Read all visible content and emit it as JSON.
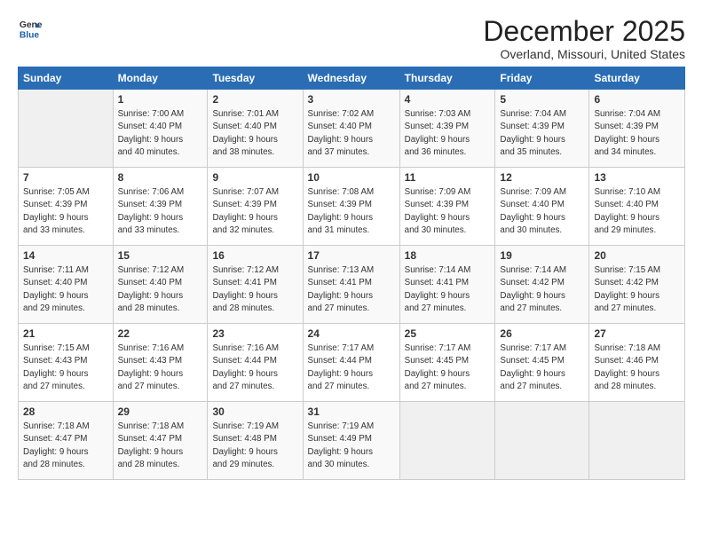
{
  "header": {
    "logo_line1": "General",
    "logo_line2": "Blue",
    "month": "December 2025",
    "location": "Overland, Missouri, United States"
  },
  "days_of_week": [
    "Sunday",
    "Monday",
    "Tuesday",
    "Wednesday",
    "Thursday",
    "Friday",
    "Saturday"
  ],
  "weeks": [
    [
      {
        "day": "",
        "info": ""
      },
      {
        "day": "1",
        "info": "Sunrise: 7:00 AM\nSunset: 4:40 PM\nDaylight: 9 hours\nand 40 minutes."
      },
      {
        "day": "2",
        "info": "Sunrise: 7:01 AM\nSunset: 4:40 PM\nDaylight: 9 hours\nand 38 minutes."
      },
      {
        "day": "3",
        "info": "Sunrise: 7:02 AM\nSunset: 4:40 PM\nDaylight: 9 hours\nand 37 minutes."
      },
      {
        "day": "4",
        "info": "Sunrise: 7:03 AM\nSunset: 4:39 PM\nDaylight: 9 hours\nand 36 minutes."
      },
      {
        "day": "5",
        "info": "Sunrise: 7:04 AM\nSunset: 4:39 PM\nDaylight: 9 hours\nand 35 minutes."
      },
      {
        "day": "6",
        "info": "Sunrise: 7:04 AM\nSunset: 4:39 PM\nDaylight: 9 hours\nand 34 minutes."
      }
    ],
    [
      {
        "day": "7",
        "info": "Sunrise: 7:05 AM\nSunset: 4:39 PM\nDaylight: 9 hours\nand 33 minutes."
      },
      {
        "day": "8",
        "info": "Sunrise: 7:06 AM\nSunset: 4:39 PM\nDaylight: 9 hours\nand 33 minutes."
      },
      {
        "day": "9",
        "info": "Sunrise: 7:07 AM\nSunset: 4:39 PM\nDaylight: 9 hours\nand 32 minutes."
      },
      {
        "day": "10",
        "info": "Sunrise: 7:08 AM\nSunset: 4:39 PM\nDaylight: 9 hours\nand 31 minutes."
      },
      {
        "day": "11",
        "info": "Sunrise: 7:09 AM\nSunset: 4:39 PM\nDaylight: 9 hours\nand 30 minutes."
      },
      {
        "day": "12",
        "info": "Sunrise: 7:09 AM\nSunset: 4:40 PM\nDaylight: 9 hours\nand 30 minutes."
      },
      {
        "day": "13",
        "info": "Sunrise: 7:10 AM\nSunset: 4:40 PM\nDaylight: 9 hours\nand 29 minutes."
      }
    ],
    [
      {
        "day": "14",
        "info": "Sunrise: 7:11 AM\nSunset: 4:40 PM\nDaylight: 9 hours\nand 29 minutes."
      },
      {
        "day": "15",
        "info": "Sunrise: 7:12 AM\nSunset: 4:40 PM\nDaylight: 9 hours\nand 28 minutes."
      },
      {
        "day": "16",
        "info": "Sunrise: 7:12 AM\nSunset: 4:41 PM\nDaylight: 9 hours\nand 28 minutes."
      },
      {
        "day": "17",
        "info": "Sunrise: 7:13 AM\nSunset: 4:41 PM\nDaylight: 9 hours\nand 27 minutes."
      },
      {
        "day": "18",
        "info": "Sunrise: 7:14 AM\nSunset: 4:41 PM\nDaylight: 9 hours\nand 27 minutes."
      },
      {
        "day": "19",
        "info": "Sunrise: 7:14 AM\nSunset: 4:42 PM\nDaylight: 9 hours\nand 27 minutes."
      },
      {
        "day": "20",
        "info": "Sunrise: 7:15 AM\nSunset: 4:42 PM\nDaylight: 9 hours\nand 27 minutes."
      }
    ],
    [
      {
        "day": "21",
        "info": "Sunrise: 7:15 AM\nSunset: 4:43 PM\nDaylight: 9 hours\nand 27 minutes."
      },
      {
        "day": "22",
        "info": "Sunrise: 7:16 AM\nSunset: 4:43 PM\nDaylight: 9 hours\nand 27 minutes."
      },
      {
        "day": "23",
        "info": "Sunrise: 7:16 AM\nSunset: 4:44 PM\nDaylight: 9 hours\nand 27 minutes."
      },
      {
        "day": "24",
        "info": "Sunrise: 7:17 AM\nSunset: 4:44 PM\nDaylight: 9 hours\nand 27 minutes."
      },
      {
        "day": "25",
        "info": "Sunrise: 7:17 AM\nSunset: 4:45 PM\nDaylight: 9 hours\nand 27 minutes."
      },
      {
        "day": "26",
        "info": "Sunrise: 7:17 AM\nSunset: 4:45 PM\nDaylight: 9 hours\nand 27 minutes."
      },
      {
        "day": "27",
        "info": "Sunrise: 7:18 AM\nSunset: 4:46 PM\nDaylight: 9 hours\nand 28 minutes."
      }
    ],
    [
      {
        "day": "28",
        "info": "Sunrise: 7:18 AM\nSunset: 4:47 PM\nDaylight: 9 hours\nand 28 minutes."
      },
      {
        "day": "29",
        "info": "Sunrise: 7:18 AM\nSunset: 4:47 PM\nDaylight: 9 hours\nand 28 minutes."
      },
      {
        "day": "30",
        "info": "Sunrise: 7:19 AM\nSunset: 4:48 PM\nDaylight: 9 hours\nand 29 minutes."
      },
      {
        "day": "31",
        "info": "Sunrise: 7:19 AM\nSunset: 4:49 PM\nDaylight: 9 hours\nand 30 minutes."
      },
      {
        "day": "",
        "info": ""
      },
      {
        "day": "",
        "info": ""
      },
      {
        "day": "",
        "info": ""
      }
    ]
  ]
}
